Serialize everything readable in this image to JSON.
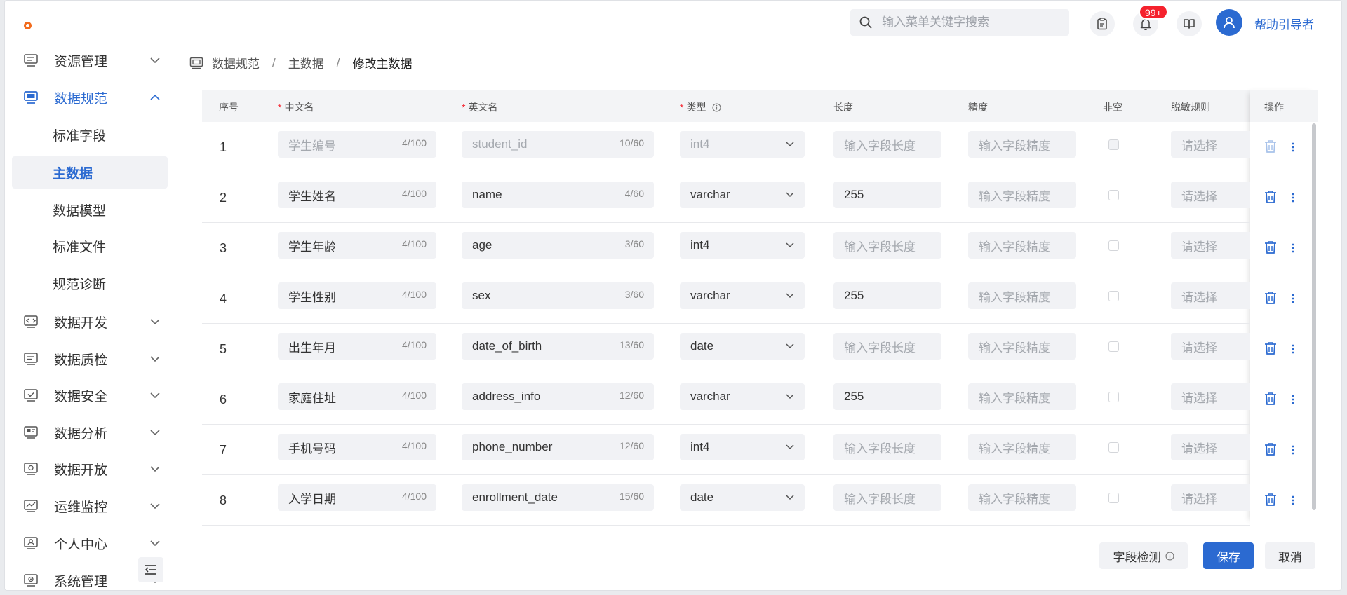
{
  "topbar": {
    "search_placeholder": "输入菜单关键字搜索",
    "notification_count": "99+",
    "helper_label": "帮助引导者"
  },
  "sidebar": {
    "items": [
      {
        "label": "资源管理",
        "icon": "resource-icon",
        "state": "collapsed"
      },
      {
        "label": "数据规范",
        "icon": "data-standard-icon",
        "state": "expanded"
      },
      {
        "label": "标准字段",
        "sub": true
      },
      {
        "label": "主数据",
        "sub": true,
        "active": true
      },
      {
        "label": "数据模型",
        "sub": true
      },
      {
        "label": "标准文件",
        "sub": true
      },
      {
        "label": "规范诊断",
        "sub": true
      },
      {
        "label": "数据开发",
        "icon": "code-icon",
        "state": "collapsed"
      },
      {
        "label": "数据质检",
        "icon": "quality-icon",
        "state": "collapsed"
      },
      {
        "label": "数据安全",
        "icon": "security-icon",
        "state": "collapsed"
      },
      {
        "label": "数据分析",
        "icon": "analysis-icon",
        "state": "collapsed"
      },
      {
        "label": "数据开放",
        "icon": "open-icon",
        "state": "collapsed"
      },
      {
        "label": "运维监控",
        "icon": "monitor-icon",
        "state": "collapsed"
      },
      {
        "label": "个人中心",
        "icon": "user-center-icon",
        "state": "collapsed"
      },
      {
        "label": "系统管理",
        "icon": "system-icon",
        "state": "collapsed"
      }
    ]
  },
  "breadcrumb": [
    "数据规范",
    "主数据",
    "修改主数据"
  ],
  "table": {
    "headers": {
      "index": "序号",
      "cn_name": "中文名",
      "en_name": "英文名",
      "type": "类型",
      "length": "长度",
      "precision": "精度",
      "not_null": "非空",
      "mask_rule": "脱敏规则",
      "actions": "操作"
    },
    "length_placeholder": "输入字段长度",
    "precision_placeholder": "输入字段精度",
    "mask_placeholder": "请选择",
    "rows": [
      {
        "idx": "1",
        "cn": "学生编号",
        "cn_count": "4/100",
        "en": "student_id",
        "en_count": "10/60",
        "type": "int4",
        "length": "",
        "disabled": true
      },
      {
        "idx": "2",
        "cn": "学生姓名",
        "cn_count": "4/100",
        "en": "name",
        "en_count": "4/60",
        "type": "varchar",
        "length": "255"
      },
      {
        "idx": "3",
        "cn": "学生年龄",
        "cn_count": "4/100",
        "en": "age",
        "en_count": "3/60",
        "type": "int4",
        "length": ""
      },
      {
        "idx": "4",
        "cn": "学生性别",
        "cn_count": "4/100",
        "en": "sex",
        "en_count": "3/60",
        "type": "varchar",
        "length": "255"
      },
      {
        "idx": "5",
        "cn": "出生年月",
        "cn_count": "4/100",
        "en": "date_of_birth",
        "en_count": "13/60",
        "type": "date",
        "length": ""
      },
      {
        "idx": "6",
        "cn": "家庭住址",
        "cn_count": "4/100",
        "en": "address_info",
        "en_count": "12/60",
        "type": "varchar",
        "length": "255"
      },
      {
        "idx": "7",
        "cn": "手机号码",
        "cn_count": "4/100",
        "en": "phone_number",
        "en_count": "12/60",
        "type": "int4",
        "length": ""
      },
      {
        "idx": "8",
        "cn": "入学日期",
        "cn_count": "4/100",
        "en": "enrollment_date",
        "en_count": "15/60",
        "type": "date",
        "length": ""
      }
    ]
  },
  "footer": {
    "check_label": "字段检测",
    "save_label": "保存",
    "cancel_label": "取消"
  },
  "colors": {
    "primary": "#2b6ad1",
    "required": "#f5222d",
    "badge": "#f5222d",
    "logo": "#f26b1d"
  }
}
